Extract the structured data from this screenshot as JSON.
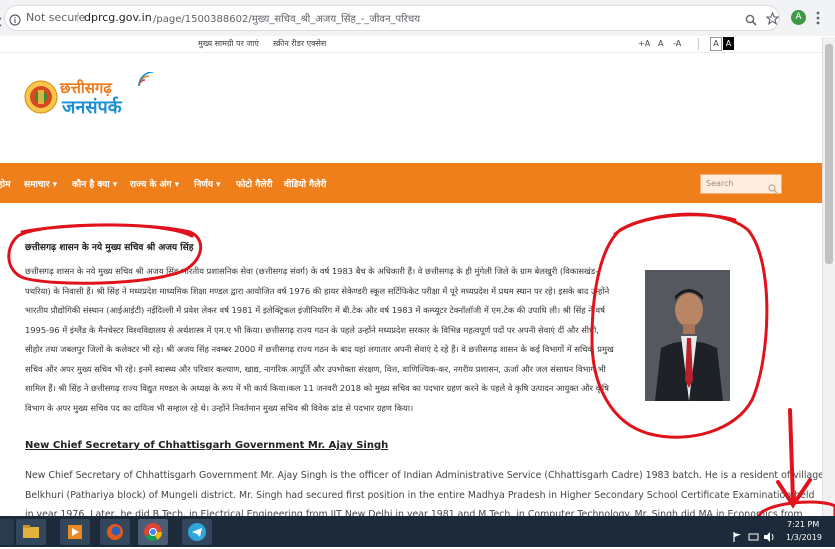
{
  "browser": {
    "security_label": "Not secure",
    "url_domain": "dprcg.gov.in",
    "url_path": "/page/1500388602/मुख्य_सचिव_श्री_अजय_सिंह_-_जीवन_परिचय",
    "profile_initial": "A"
  },
  "utility": {
    "skip_to_content": "मुख्य सामग्री पर जाएं",
    "screen_reader": "स्क्रीन रीडर एक्सेस",
    "font_increase": "+A",
    "font_normal": "A",
    "font_decrease": "-A",
    "contrast_light": "A",
    "contrast_dark": "A"
  },
  "logo": {
    "line1": "छत्तीसगढ़",
    "line2": "जनसंपर्क"
  },
  "nav": {
    "items": [
      {
        "label": "होम"
      },
      {
        "label": "समाचार ▾"
      },
      {
        "label": "कौन है क्या ▾"
      },
      {
        "label": "राज्य के अंग ▾"
      },
      {
        "label": "निर्णय ▾"
      },
      {
        "label": "फोटो गैलेरी"
      },
      {
        "label": "वीडियो गैलेरी"
      }
    ],
    "search_placeholder": "Search"
  },
  "article": {
    "hindi_title": "छत्तीसगढ़ शासन के नये मुख्य सचिव श्री अजय सिंह",
    "hindi_lines": [
      "छत्तीसगढ़ शासन के नये मुख्य सचिव श्री अजय सिंह भारतीय प्रशासनिक सेवा (छत्तीसगढ़ संवर्ग) के वर्ष 1983 बैच के अधिकारी हैं। वे छत्तीसगढ़ के ही मुंगेली जिले के ग्राम बेलखुरी (विकासखंड-",
      "पथरिया) के निवासी हैं। श्री सिंह ने मध्यप्रदेश माध्यमिक शिक्षा मण्डल द्वारा आयोजित वर्ष 1976 की हायर सेकेण्डरी स्कूल सर्टिफिकेट परीक्षा में पूरे मध्यप्रदेश में प्रथम स्थान पर रहे। इसके बाद उन्होंने",
      "भारतीय प्रौद्योगिकी संस्थान (आईआईटी) नईदिल्ली में प्रवेश लेकर वर्ष 1981 में इलेक्ट्रिकल इंजीनियरिंग में बी.टेक और वर्ष 1983 में कम्प्यूटर टेक्नॉलॉजी में एम.टेक की उपाधि ली। श्री सिंह ने वर्ष",
      "1995-96 में इंग्लैंड के मैनचेस्टर विश्वविद्यालय से अर्थशास्त्र में एम.ए भी किया। छत्तीसगढ़ राज्य गठन के पहले उन्होंने मध्यप्रदेश सरकार के विभिन्न महत्वपूर्ण पदों पर अपनी सेवाएं दीं और सीधी,",
      "सीहोर तथा जबलपुर जिलों के कलेक्टर भी रहे। श्री अजय सिंह नवम्बर 2000 में छत्तीसगढ़ राज्य गठन के बाद यहां लगातार अपनी सेवाएं दे रहे हैं। वे छत्तीसगढ़ शासन के कई विभागों में सचिव, प्रमुख",
      "सचिव और अपर मुख्य सचिव भी रहे। इनमें स्वास्थ्य और परिवार कल्याण, खाद्य, नागरिक आपूर्ति और उपभोक्ता संरक्षण, वित्त, वाणिज्यिक-कर, नगरीय प्रशासन, ऊर्जा और जल संसाधन विभाग भी",
      "शामिल हैं। श्री सिंह ने छत्तीसगढ़ राज्य विद्युत मण्डल के अध्यक्ष के रूप में भी कार्य किया।कल 11 जनवरी 2018 को मुख्य सचिव का पदभार ग्रहण करने के पहले वे कृषि उत्पादन आयुक्त और कृषि",
      "विभाग के अपर मुख्य सचिव पद का दायित्व भी सम्हाल रहे थे। उन्होंने निवर्तमान मुख्य सचिव श्री विवेक ढांड से पदभार ग्रहण किया।"
    ],
    "english_title": "New Chief Secretary of Chhattisgarh Government Mr. Ajay Singh",
    "english_lines": [
      "New Chief Secretary of Chhattisgarh Government Mr. Ajay Singh is the officer of Indian Administrative Service (Chhattisgarh Cadre) 1983 batch. He is a resident of village",
      "Belkhuri (Pathariya block) of Mungeli district. Mr. Singh had secured first position in the entire Madhya Pradesh in Higher Secondary School Certificate Examination held",
      "in year 1976. Later, he did B.Tech. in Electrical Engineering from IIT New Delhi in year 1981 and M.Tech. in Computer Technology. Mr. Singh did MA in Economics from"
    ]
  },
  "taskbar": {
    "time": "7:21 PM",
    "date": "1/3/2019"
  },
  "colors": {
    "nav_orange": "#ee7f1a",
    "annotation_red": "#e0121b",
    "taskbar": "#1c2a3a"
  }
}
